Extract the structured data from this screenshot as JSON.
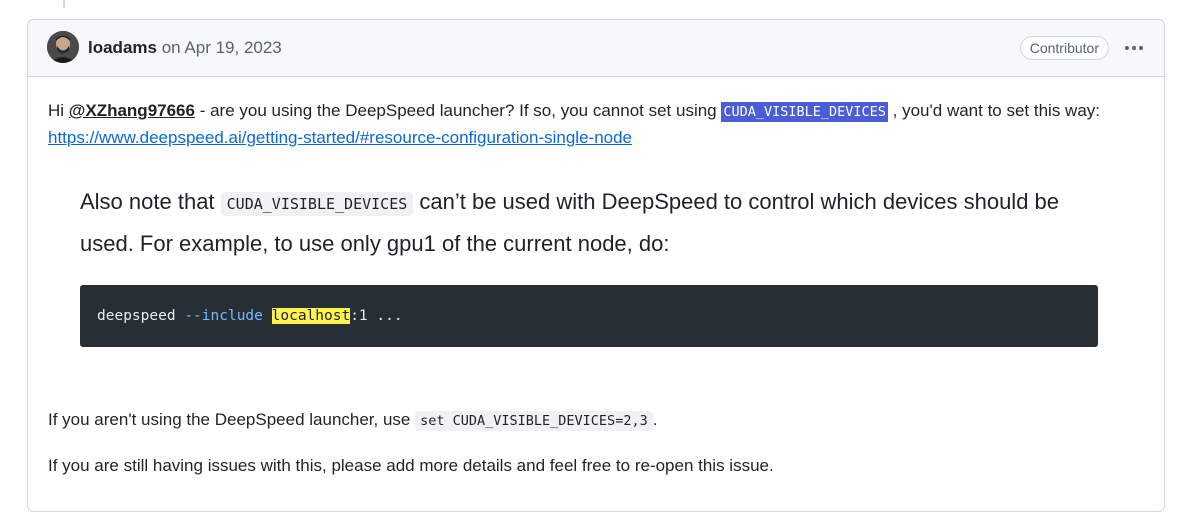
{
  "comment": {
    "author": "loadams",
    "date_text": "on Apr 19, 2023",
    "badge": "Contributor",
    "more_icon": "kebab-horizontal-icon",
    "paragraph1": {
      "prefix": "Hi ",
      "mention": "@XZhang97666",
      "text1": " - are you using the DeepSpeed launcher? If so, you cannot set using ",
      "code": "CUDA_VISIBLE_DEVICES",
      "text2": " , you'd want to set this way:",
      "link": "https://www.deepspeed.ai/getting-started/#resource-configuration-single-node"
    },
    "quote": {
      "text1": "Also note that ",
      "code": "CUDA_VISIBLE_DEVICES",
      "text2": " can’t be used with DeepSpeed to control which devices should be used. For example, to use only gpu1 of the current node, do:"
    },
    "codeblock": {
      "cmd": "deepspeed",
      "flag": "--include",
      "highlight": "localhost",
      "rest": ":1 ..."
    },
    "paragraph2": {
      "text": "If you aren't using the DeepSpeed launcher, use ",
      "code": "set CUDA_VISIBLE_DEVICES=2,3",
      "suffix": "."
    },
    "paragraph3": "If you are still having issues with this, please add more details and feel free to re-open this issue."
  },
  "colors": {
    "border": "#d0d7de",
    "header_bg": "#f6f8fa",
    "link": "#0969da",
    "selection": "#4a5dd6",
    "code_block_bg": "#262f33",
    "highlight": "#fff34d"
  }
}
